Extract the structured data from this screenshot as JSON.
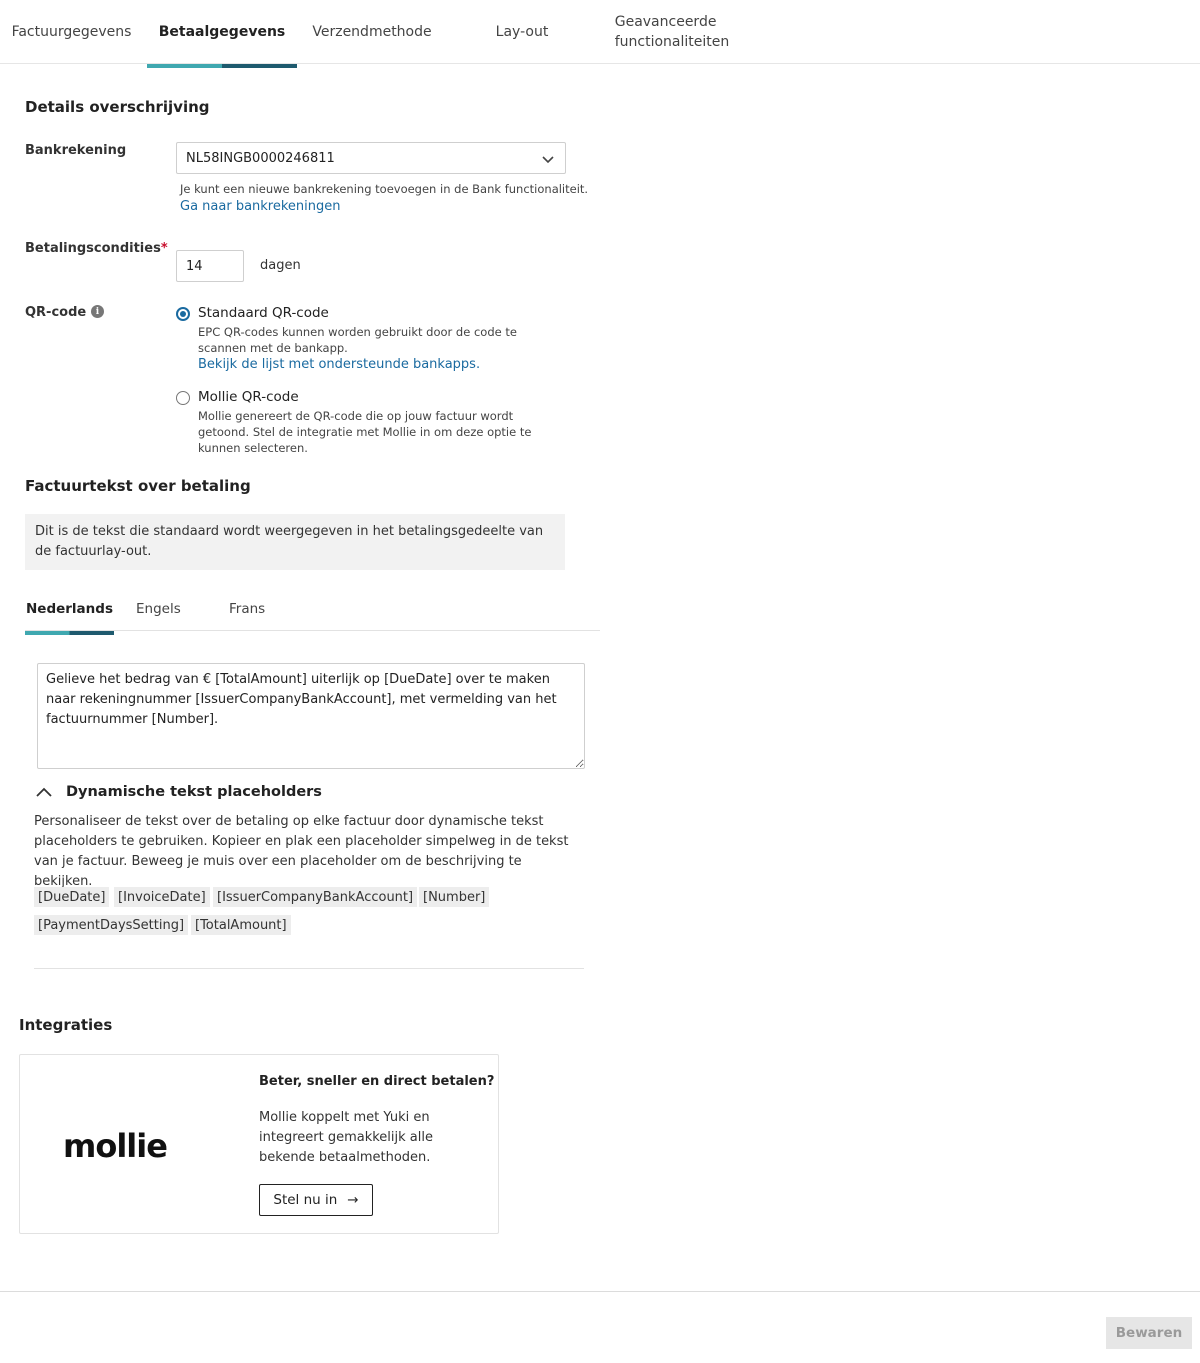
{
  "tabs": [
    {
      "label": "Factuurgegevens",
      "active": false
    },
    {
      "label": "Betaalgegevens",
      "active": true
    },
    {
      "label": "Verzendmethode",
      "active": false
    },
    {
      "label": "Lay-out",
      "active": false
    },
    {
      "label": "Geavanceerde functionaliteiten",
      "line1": "Geavanceerde",
      "line2": "functionaliteiten",
      "active": false
    }
  ],
  "transfer": {
    "title": "Details overschrijving",
    "bank_label": "Bankrekening",
    "bank_value": "NL58INGB0000246811",
    "bank_help": "Je kunt een nieuwe bankrekening toevoegen in de Bank functionaliteit.",
    "bank_link": "Ga naar bankrekeningen",
    "terms_label": "Betalingscondities",
    "terms_required": "*",
    "terms_value": "14",
    "terms_unit": "dagen",
    "qr_label": "QR-code",
    "qr_options": [
      {
        "label": "Standaard QR-code",
        "selected": true,
        "desc": "EPC QR-codes kunnen worden gebruikt door de code te scannen met de bankapp.",
        "link": "Bekijk de lijst met ondersteunde bankapps."
      },
      {
        "label": "Mollie QR-code",
        "selected": false,
        "desc": "Mollie genereert de QR-code die op jouw factuur wordt getoond. Stel de integratie met Mollie in om deze optie te kunnen selecteren."
      }
    ]
  },
  "invoice_text": {
    "title": "Factuurtekst over betaling",
    "info": "Dit is de tekst die standaard wordt weergegeven in het betalingsgedeelte van de factuurlay-out.",
    "languages": [
      {
        "label": "Nederlands",
        "active": true
      },
      {
        "label": "Engels",
        "active": false
      },
      {
        "label": "Frans",
        "active": false
      }
    ],
    "text": "Gelieve het bedrag van € [TotalAmount] uiterlijk op [DueDate] over te maken naar rekeningnummer [IssuerCompanyBankAccount], met vermelding van het factuurnummer [Number].",
    "placeholders_title": "Dynamische tekst placeholders",
    "placeholders_desc": "Personaliseer de tekst over de betaling op elke factuur door dynamische tekst placeholders te gebruiken. Kopieer en plak een placeholder simpelweg in de tekst van je factuur. Beweeg je muis over een placeholder om de beschrijving te bekijken.",
    "placeholders": [
      "[DueDate]",
      "[InvoiceDate]",
      "[IssuerCompanyBankAccount]",
      "[Number]",
      "[PaymentDaysSetting]",
      "[TotalAmount]"
    ]
  },
  "integrations": {
    "title": "Integraties",
    "card": {
      "logo": "mollie",
      "title": "Beter, sneller en direct betalen?",
      "text": "Mollie koppelt met Yuki en integreert gemakkelijk alle bekende betaalmethoden.",
      "button": "Stel nu in",
      "button_icon": "→"
    }
  },
  "footer": {
    "save": "Bewaren"
  },
  "colors": {
    "accent_teal": "#3fa8b0",
    "accent_dark": "#1e5a6e",
    "link": "#1a6aa0",
    "required": "#c8102e"
  }
}
